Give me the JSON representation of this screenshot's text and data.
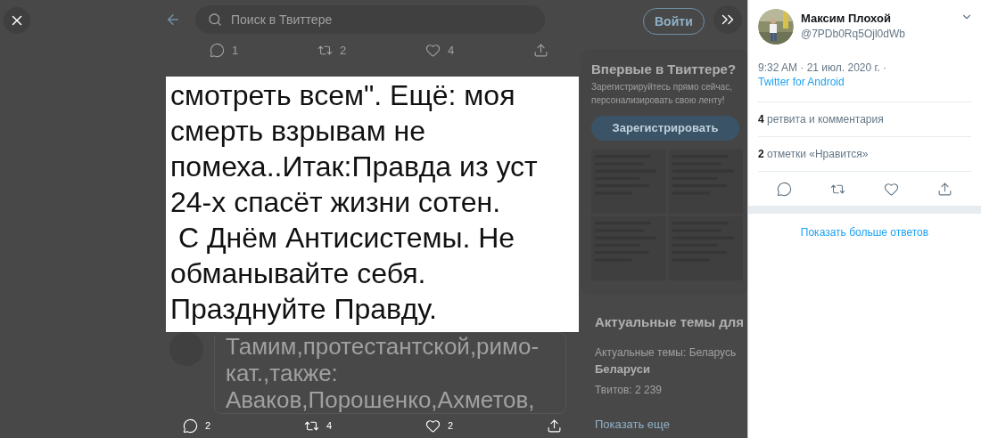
{
  "background": {
    "search": {
      "placeholder": "Поиск в Твиттере"
    },
    "login_button": "Войти",
    "tweet_actions": [
      {
        "kind": "reply",
        "count": "1"
      },
      {
        "kind": "retweet",
        "count": "2"
      },
      {
        "kind": "like",
        "count": "4"
      },
      {
        "kind": "share"
      }
    ],
    "signup": {
      "title": "Впервые в Твиттере?",
      "lines": [
        "Зарегистрируйтесь прямо сейчас,",
        "персонализировать свою ленту!"
      ],
      "button": "Зарегистрировать"
    },
    "trends": {
      "title": "Актуальные темы для",
      "items": [
        {
          "context": "Актуальные темы: Беларусь",
          "name": "Беларуси",
          "count": "Твитов: 2 239"
        }
      ],
      "more": "Показать еще"
    },
    "tweet_text_lines": [
      "Тамим,протестантской,римо-",
      "кат.,также:",
      "Аваков,Порошенко,Ахметов,"
    ]
  },
  "media": {
    "lines": [
      "смотреть всем\". Ещё: моя",
      "смерть взрывам не",
      "помеха..Итак:Правда из уст",
      "24-х спасёт жизни сотен.",
      " С Днём Антисистемы. Не",
      "обманывайте себя.",
      "Празднуйте Правду."
    ]
  },
  "media_actions": [
    {
      "kind": "reply",
      "count": "2"
    },
    {
      "kind": "retweet",
      "count": "4"
    },
    {
      "kind": "like",
      "count": "2"
    },
    {
      "kind": "share"
    }
  ],
  "tweet_panel": {
    "name": "Максим Плохой",
    "handle": "@7PDb0Rq5Ojl0dWb",
    "time": "9:32 AM · 21 июл. 2020 г. ·",
    "source": "Twitter for Android",
    "stats": [
      "**4** ретвита и комментария",
      "**2** отметки «Нравится»"
    ],
    "actions": [
      {
        "kind": "reply"
      },
      {
        "kind": "retweet"
      },
      {
        "kind": "like"
      },
      {
        "kind": "share"
      }
    ],
    "more_replies": "Показать больше ответов"
  }
}
